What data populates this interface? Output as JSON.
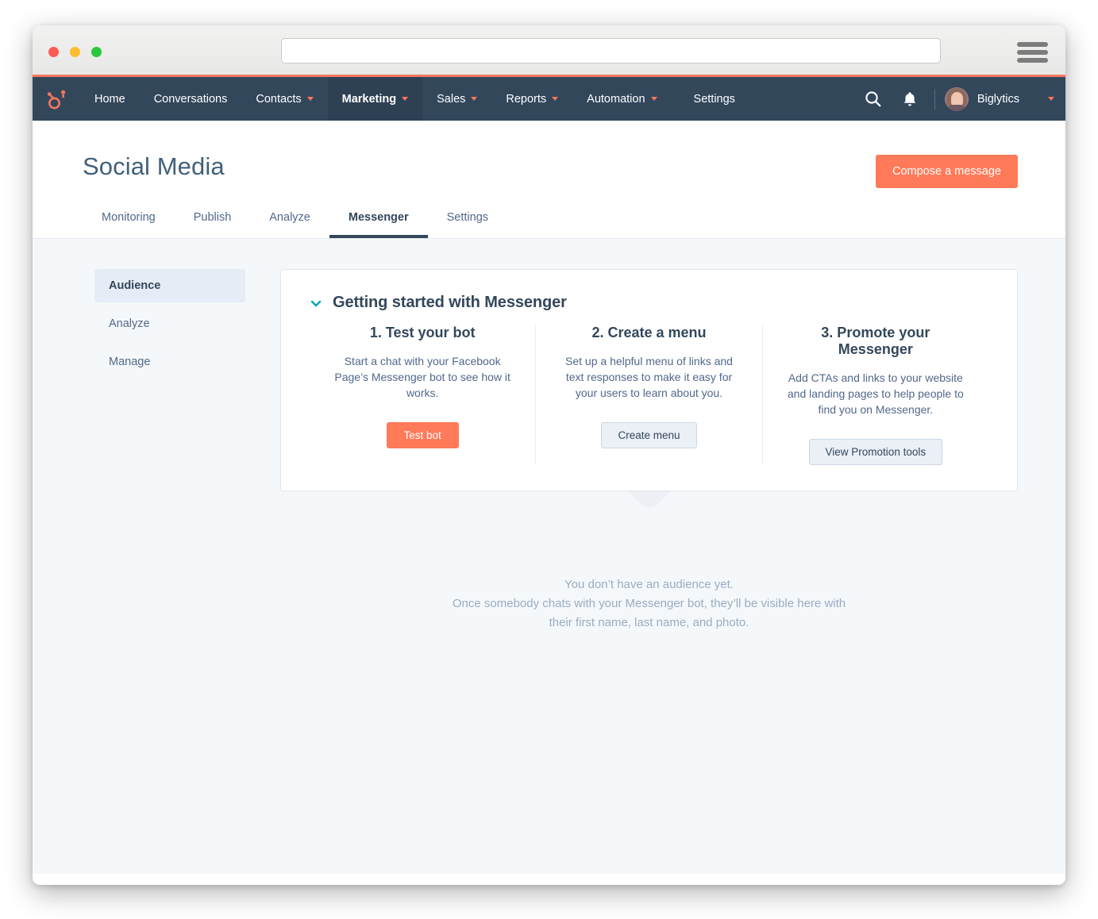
{
  "browser": {
    "url_value": "",
    "url_placeholder": "",
    "menu_icon": "hamburger-menu-icon",
    "traffic_lights": [
      "close",
      "minimize",
      "zoom"
    ]
  },
  "topnav": {
    "logo": "hubspot-sprocket-logo",
    "items": [
      {
        "label": "Home",
        "has_caret": false,
        "active": false
      },
      {
        "label": "Conversations",
        "has_caret": false,
        "active": false
      },
      {
        "label": "Contacts",
        "has_caret": true,
        "active": false
      },
      {
        "label": "Marketing",
        "has_caret": true,
        "active": true
      },
      {
        "label": "Sales",
        "has_caret": true,
        "active": false
      },
      {
        "label": "Reports",
        "has_caret": true,
        "active": false
      },
      {
        "label": "Automation",
        "has_caret": true,
        "active": false
      },
      {
        "label": "Settings",
        "has_caret": false,
        "active": false
      }
    ],
    "search_icon": "search-icon",
    "notifications_icon": "bell-icon",
    "account_name": "Biglytics",
    "account_caret_icon": "chevron-down-icon",
    "avatar": "user-avatar-photo"
  },
  "header": {
    "title": "Social Media",
    "compose_label": "Compose a message"
  },
  "tabs": [
    {
      "label": "Monitoring",
      "active": false
    },
    {
      "label": "Publish",
      "active": false
    },
    {
      "label": "Analyze",
      "active": false
    },
    {
      "label": "Messenger",
      "active": true
    },
    {
      "label": "Settings",
      "active": false
    }
  ],
  "sidebar": {
    "items": [
      {
        "label": "Audience",
        "active": true
      },
      {
        "label": "Analyze",
        "active": false
      },
      {
        "label": "Manage",
        "active": false
      }
    ]
  },
  "card": {
    "collapse_icon": "chevron-down-icon",
    "title": "Getting started with Messenger",
    "steps": [
      {
        "title": "1. Test your bot",
        "description": "Start a chat with your Facebook Page’s Messenger bot to see how it works.",
        "button_label": "Test bot",
        "button_style": "primary"
      },
      {
        "title": "2. Create a menu",
        "description": "Set up a helpful menu of links and text responses to make it easy for your users to learn about you.",
        "button_label": "Create menu",
        "button_style": "secondary"
      },
      {
        "title": "3. Promote your Messenger",
        "description": "Add CTAs and links to your website and landing pages to help people to find you on Messenger.",
        "button_label": "View Promotion tools",
        "button_style": "secondary"
      }
    ]
  },
  "empty_state": {
    "illustration": "empty-audience-illustration",
    "line1": "You don’t have an audience yet.",
    "line2": "Once somebody chats with your Messenger bot, they’ll be visible here with",
    "line3": "their first name, last name, and photo."
  },
  "colors": {
    "accent_orange": "#ff7a59",
    "nav_dark": "#33475b",
    "nav_active": "#2e4054",
    "teal_chevron": "#00a4bd",
    "body_bg": "#f5f8fa",
    "muted_text": "#99acc2"
  }
}
